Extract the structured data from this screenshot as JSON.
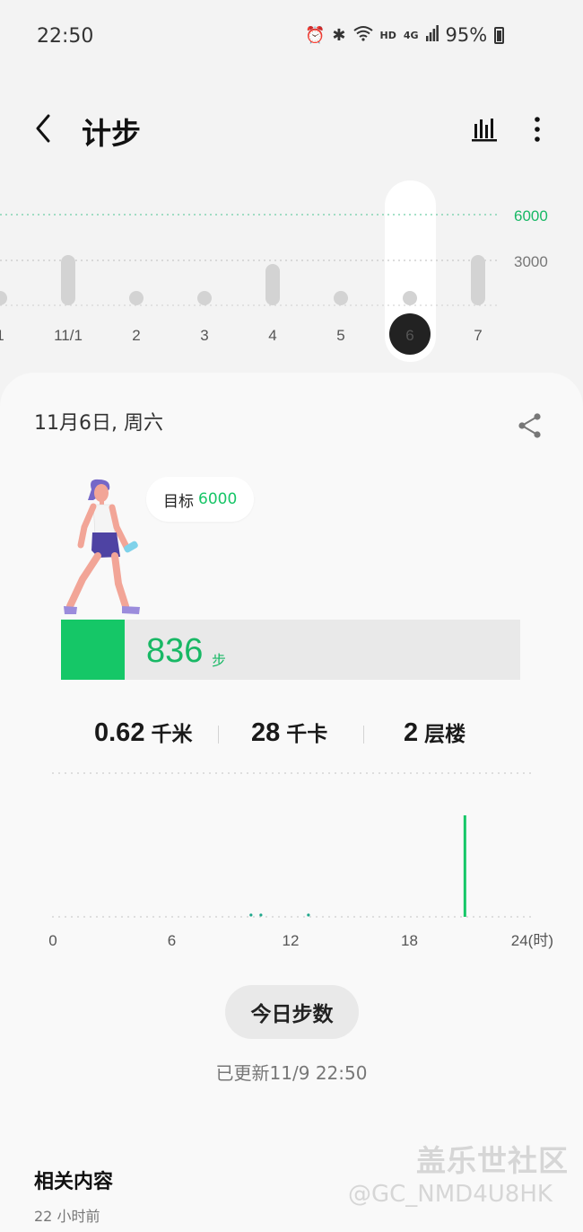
{
  "status_bar": {
    "time": "22:50",
    "network_label": "HD",
    "network_type": "4G",
    "battery": "95%"
  },
  "header": {
    "title": "计步",
    "icons": [
      "back-icon",
      "bar-chart-icon",
      "more-vert-icon"
    ]
  },
  "week_chart": {
    "goal_line_label": "6000",
    "mid_line_label": "3000",
    "days": [
      {
        "label": "1",
        "level": "low"
      },
      {
        "label": "11/1",
        "level": "high"
      },
      {
        "label": "2",
        "level": "low"
      },
      {
        "label": "3",
        "level": "low"
      },
      {
        "label": "4",
        "level": "mid"
      },
      {
        "label": "5",
        "level": "low"
      },
      {
        "label": "6",
        "level": "low",
        "selected": true
      },
      {
        "label": "7",
        "level": "high"
      }
    ]
  },
  "detail": {
    "date": "11月6日, 周六",
    "goal_label": "目标",
    "goal_value": "6000",
    "steps": "836",
    "steps_unit": "步",
    "progress_fraction": 0.139,
    "metrics": [
      {
        "value": "0.62",
        "unit": "千米"
      },
      {
        "value": "28",
        "unit": "千卡"
      },
      {
        "value": "2",
        "unit": "层楼"
      }
    ]
  },
  "day_chart": {
    "x_ticks": [
      "0",
      "6",
      "12",
      "18",
      "24(时)"
    ],
    "activity_hours": [
      10.0,
      10.5,
      12.9
    ],
    "peak_hour": 20.8
  },
  "today_button": "今日步数",
  "updated_text": "已更新11/9 22:50",
  "related": {
    "title": "相关内容",
    "time": "22 小时前"
  },
  "watermark": {
    "line1": "盖乐世社区",
    "line2": "@GC_NMD4U8HK"
  },
  "colors": {
    "accent_green": "#15c767",
    "goal_text_green": "#17c567"
  }
}
